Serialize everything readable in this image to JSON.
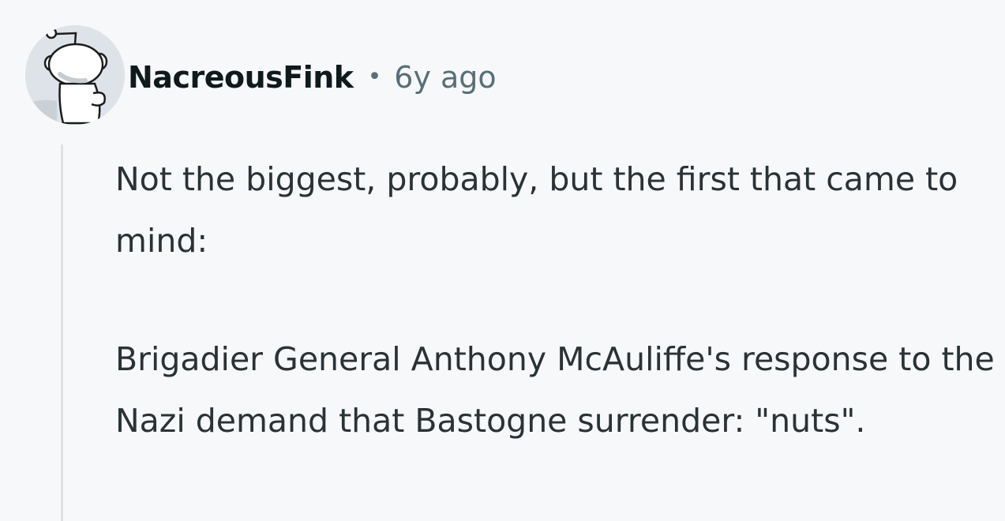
{
  "comment": {
    "username": "NacreousFink",
    "separator": "•",
    "timestamp": "6y ago",
    "paragraphs": [
      "Not the biggest, probably, but the first that came to mind:",
      "Brigadier General Anthony McAuliffe's response to the Nazi demand that Bastogne surrender: \"nuts\"."
    ]
  },
  "colors": {
    "background": "#f7f8fa",
    "username": "#0f1a1c",
    "meta": "#576f76",
    "body_text": "#2a3236",
    "thread_line": "#dce2e6"
  },
  "icons": {
    "avatar": "snoo-avatar-icon"
  }
}
